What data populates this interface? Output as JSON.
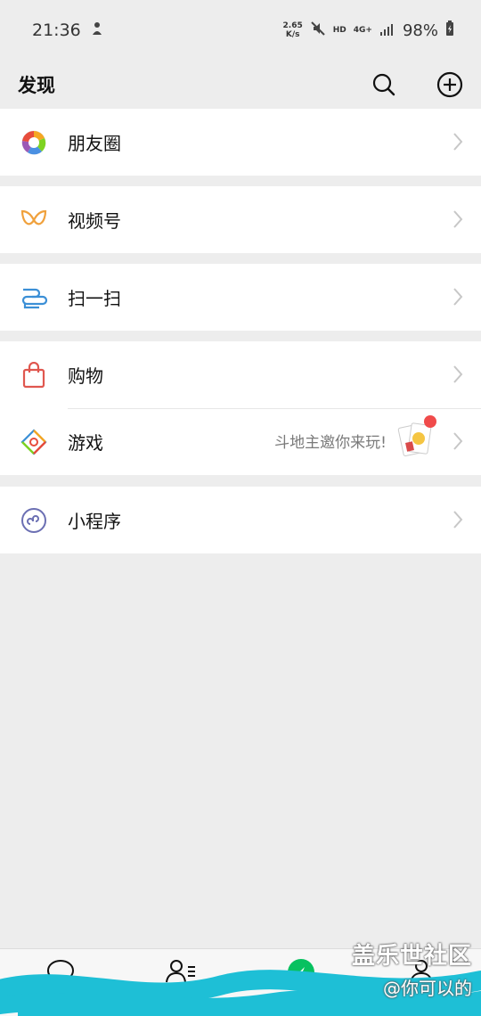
{
  "status": {
    "time": "21:36",
    "speed_top": "2.65",
    "speed_bottom": "K/s",
    "hd": "HD",
    "net": "4G+",
    "battery": "98%"
  },
  "header": {
    "title": "发现"
  },
  "items": {
    "moments": "朋友圈",
    "channels": "视频号",
    "scan": "扫一扫",
    "shopping": "购物",
    "games": "游戏",
    "games_promo": "斗地主邀你来玩!",
    "miniprograms": "小程序"
  },
  "watermark": {
    "line1": "盖乐世社区",
    "line2": "@你可以的"
  },
  "colors": {
    "background": "#ededed",
    "accent_green": "#07c160",
    "badge_red": "#f04b4b",
    "scribble": "#1ebfd6"
  }
}
